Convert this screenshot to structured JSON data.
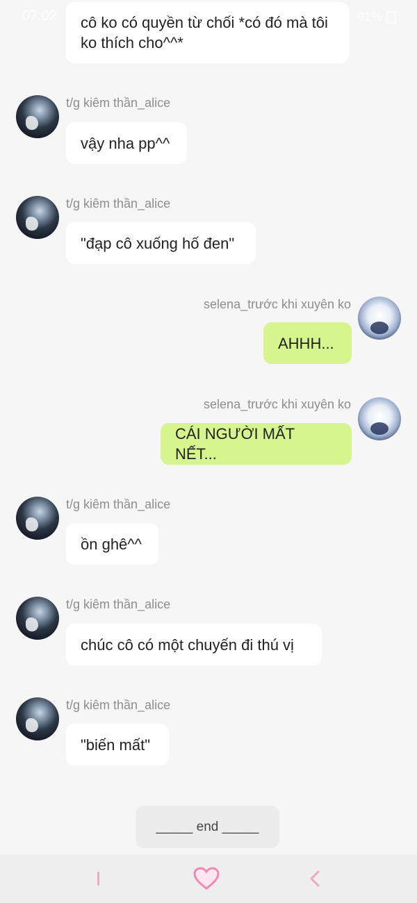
{
  "status_bar": {
    "time": "07:02",
    "battery": "91%"
  },
  "messages": [
    {
      "sender": "",
      "side": "left",
      "text": "cô ko có quyền từ chối *có đó mà tôi ko thích cho^^*"
    },
    {
      "sender": "t/g kiêm thần_alice",
      "side": "left",
      "text": "vậy nha pp^^"
    },
    {
      "sender": "t/g kiêm thần_alice",
      "side": "left",
      "text": "\"đạp cô xuống hố đen\""
    },
    {
      "sender": "selena_trước khi xuyên ko",
      "side": "right",
      "text": "AHHH..."
    },
    {
      "sender": "selena_trước khi xuyên ko",
      "side": "right",
      "text": "CÁI NGƯỜI MẤT NẾT..."
    },
    {
      "sender": "t/g kiêm thần_alice",
      "side": "left",
      "text": "ồn ghê^^"
    },
    {
      "sender": "t/g kiêm thần_alice",
      "side": "left",
      "text": "chúc cô có một chuyến đi thú vị"
    },
    {
      "sender": "t/g kiêm thần_alice",
      "side": "left",
      "text": "\"biến mất\""
    }
  ],
  "end_marker": "_____ end _____",
  "nav": {
    "recents_icon": "recent-apps-icon",
    "home_icon": "heart-home-icon",
    "back_icon": "back-icon",
    "accent_color": "#f0a7c0"
  }
}
